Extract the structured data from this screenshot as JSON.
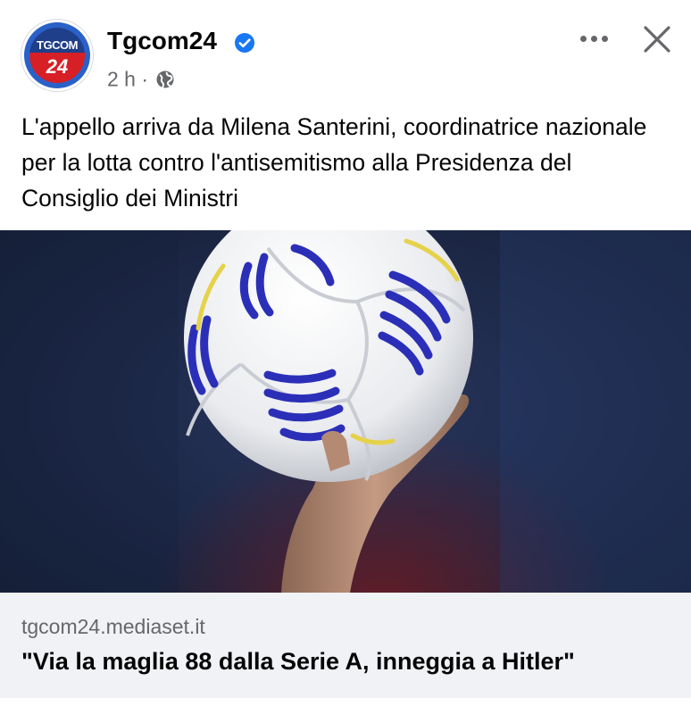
{
  "post": {
    "page_name": "Tgcom24",
    "time": "2 h",
    "separator": "·",
    "avatar_text_top": "TGCOM",
    "avatar_text_bottom": "24",
    "text": "L'appello arriva da Milena Santerini, coordinatrice nazionale per la lotta contro l'antisemitismo alla Presidenza del Consiglio dei Ministri"
  },
  "link": {
    "domain": "tgcom24.mediaset.it",
    "title": "\"Via la maglia 88 dalla Serie A, inneggia a Hitler\""
  },
  "icons": {
    "verified": "verified-badge-icon",
    "audience": "globe-icon",
    "more": "more-options-icon",
    "close": "close-icon"
  },
  "colors": {
    "verified_blue": "#1877f2",
    "secondary_text": "#65676b",
    "link_card_bg": "#f0f2f5",
    "logo_blue": "#1f3f8a",
    "logo_red": "#d71f26"
  }
}
